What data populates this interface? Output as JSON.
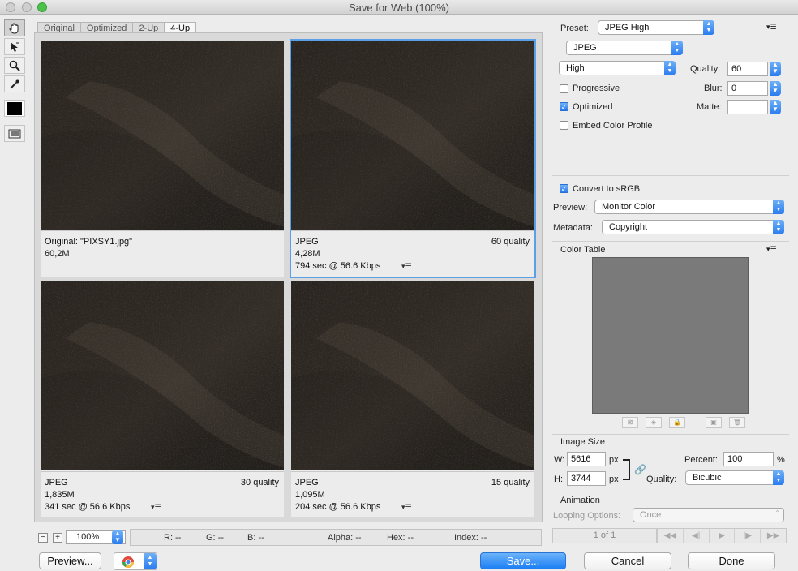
{
  "window": {
    "title": "Save for Web (100%)"
  },
  "tabs": [
    "Original",
    "Optimized",
    "2-Up",
    "4-Up"
  ],
  "panes": [
    {
      "line1": "Original: \"PIXSY1.jpg\"",
      "line2": "60,2M",
      "line3": "",
      "quality": ""
    },
    {
      "line1": "JPEG",
      "line2": "4,28M",
      "line3": "794 sec @ 56.6 Kbps",
      "quality": "60 quality"
    },
    {
      "line1": "JPEG",
      "line2": "1,835M",
      "line3": "341 sec @ 56.6 Kbps",
      "quality": "30 quality"
    },
    {
      "line1": "JPEG",
      "line2": "1,095M",
      "line3": "204 sec @ 56.6 Kbps",
      "quality": "15 quality"
    }
  ],
  "status": {
    "zoom": "100%",
    "r": "R: --",
    "g": "G: --",
    "b": "B: --",
    "alpha": "Alpha: --",
    "hex": "Hex: --",
    "index": "Index: --"
  },
  "buttons": {
    "preview": "Preview...",
    "save": "Save...",
    "cancel": "Cancel",
    "done": "Done"
  },
  "settings": {
    "preset_label": "Preset:",
    "preset_value": "JPEG High",
    "format": "JPEG",
    "compression": "High",
    "quality_label": "Quality:",
    "quality_value": "60",
    "blur_label": "Blur:",
    "blur_value": "0",
    "matte_label": "Matte:",
    "progressive": "Progressive",
    "optimized": "Optimized",
    "embed_profile": "Embed Color Profile",
    "convert_srgb": "Convert to sRGB",
    "preview_label": "Preview:",
    "preview_value": "Monitor Color",
    "metadata_label": "Metadata:",
    "metadata_value": "Copyright",
    "color_table": "Color Table",
    "image_size": "Image Size",
    "w_label": "W:",
    "w_value": "5616",
    "h_label": "H:",
    "h_value": "3744",
    "px": "px",
    "percent_label": "Percent:",
    "percent_value": "100",
    "percent_unit": "%",
    "resample_label": "Quality:",
    "resample_value": "Bicubic",
    "animation": "Animation",
    "looping_label": "Looping Options:",
    "looping_value": "Once",
    "frame_counter": "1 of 1"
  },
  "checks": {
    "progressive": false,
    "optimized": true,
    "embed_profile": false,
    "convert_srgb": true
  },
  "colors": {
    "accent": "#2a7bef",
    "selection": "#5aa0e6",
    "image_dark": "#2b2622"
  }
}
